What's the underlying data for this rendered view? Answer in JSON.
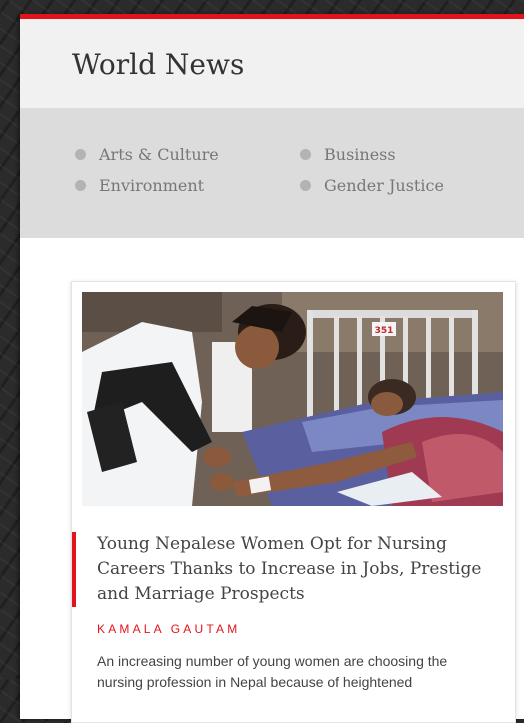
{
  "section": {
    "title": "World News"
  },
  "categories": [
    {
      "label": "Arts & Culture"
    },
    {
      "label": "Business"
    },
    {
      "label": "Environment"
    },
    {
      "label": "Gender Justice"
    }
  ],
  "article": {
    "headline": "Young Nepalese Women Opt for Nursing Careers Thanks to Increase in Jobs, Prestige and Marriage Prospects",
    "author": "KAMALA GAUTAM",
    "excerpt": "An increasing number of young women are choosing the nursing profession in Nepal because of heightened",
    "bed_number": "351"
  },
  "colors": {
    "accent": "#e3131b",
    "nav_bg": "#dcdcdc",
    "header_bg": "#f1f1f1"
  }
}
